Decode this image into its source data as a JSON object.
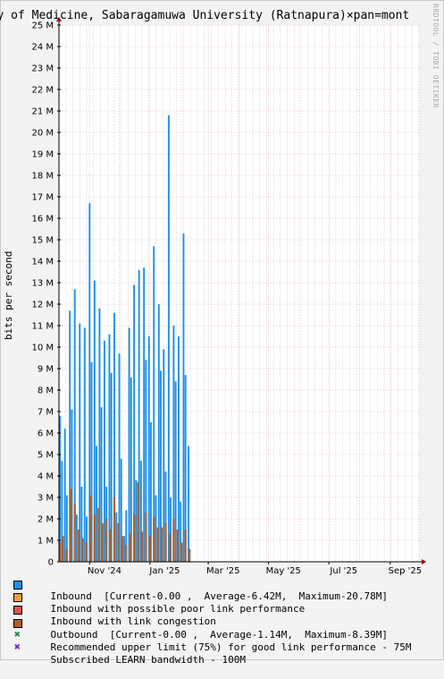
{
  "title": "ulty of Medicine, Sabaragamuwa University (Ratnapura)×pan=mont",
  "watermark": "RRDTOOL / TOBI OETIKER",
  "chart_data": {
    "type": "area",
    "ylabel": "bits per second",
    "ylim": [
      0,
      25000000
    ],
    "y_ticks": [
      "0",
      "1 M",
      "2 M",
      "3 M",
      "4 M",
      "5 M",
      "6 M",
      "7 M",
      "8 M",
      "9 M",
      "10 M",
      "11 M",
      "12 M",
      "13 M",
      "14 M",
      "15 M",
      "16 M",
      "17 M",
      "18 M",
      "19 M",
      "20 M",
      "21 M",
      "22 M",
      "23 M",
      "24 M",
      "25 M"
    ],
    "x_ticks": [
      "Nov '24",
      "Jan '25",
      "Mar '25",
      "May '25",
      "Jul '25",
      "Sep '25"
    ],
    "x_range": [
      "2024-10-01",
      "2025-10-01"
    ],
    "grid": true,
    "series": [
      {
        "name": "Inbound",
        "color": "#1e90e6",
        "x": [
          "2024-10-02",
          "2024-10-04",
          "2024-10-07",
          "2024-10-09",
          "2024-10-12",
          "2024-10-14",
          "2024-10-17",
          "2024-10-19",
          "2024-10-22",
          "2024-10-24",
          "2024-10-27",
          "2024-10-29",
          "2024-11-01",
          "2024-11-03",
          "2024-11-06",
          "2024-11-08",
          "2024-11-11",
          "2024-11-13",
          "2024-11-16",
          "2024-11-18",
          "2024-11-21",
          "2024-11-23",
          "2024-11-26",
          "2024-11-28",
          "2024-12-01",
          "2024-12-03",
          "2024-12-06",
          "2024-12-08",
          "2024-12-11",
          "2024-12-13",
          "2024-12-16",
          "2024-12-18",
          "2024-12-21",
          "2024-12-23",
          "2024-12-26",
          "2024-12-28",
          "2024-12-31",
          "2025-01-02",
          "2025-01-05",
          "2025-01-07",
          "2025-01-10",
          "2025-01-12",
          "2025-01-15",
          "2025-01-17",
          "2025-01-20",
          "2025-01-22",
          "2025-01-25",
          "2025-01-27",
          "2025-01-30",
          "2025-02-01",
          "2025-02-04",
          "2025-02-06",
          "2025-02-09",
          "2025-02-11",
          "2025-02-14",
          "2025-02-16",
          "2025-02-19",
          "2025-02-21"
        ],
        "values": [
          6800000,
          4700000,
          6200000,
          3100000,
          11700000,
          7100000,
          12700000,
          2200000,
          11100000,
          3500000,
          10900000,
          2100000,
          16700000,
          9300000,
          13100000,
          5400000,
          11800000,
          7200000,
          10300000,
          3500000,
          10600000,
          8800000,
          11600000,
          2300000,
          9700000,
          4800000,
          1200000,
          2400000,
          10900000,
          8600000,
          12900000,
          3800000,
          13600000,
          4700000,
          13700000,
          9400000,
          10500000,
          6500000,
          14700000,
          3100000,
          12000000,
          8900000,
          9900000,
          4200000,
          20800000,
          3000000,
          11000000,
          8400000,
          10500000,
          2800000,
          15300000,
          8700000,
          5400000,
          0,
          0,
          0,
          0,
          0
        ]
      },
      {
        "name": "Inbound with possible poor link performance",
        "color": "#f0a040",
        "values": []
      },
      {
        "name": "Inbound with link congestion",
        "color": "#e05050",
        "values": []
      },
      {
        "name": "Outbound",
        "color": "#b05e2a",
        "x": [
          "2024-10-02",
          "2024-10-05",
          "2024-10-09",
          "2024-10-13",
          "2024-10-17",
          "2024-10-21",
          "2024-10-25",
          "2024-10-29",
          "2024-11-02",
          "2024-11-06",
          "2024-11-10",
          "2024-11-14",
          "2024-11-18",
          "2024-11-22",
          "2024-11-26",
          "2024-11-30",
          "2024-12-04",
          "2024-12-08",
          "2024-12-12",
          "2024-12-16",
          "2024-12-20",
          "2024-12-24",
          "2024-12-28",
          "2025-01-01",
          "2025-01-05",
          "2025-01-09",
          "2025-01-13",
          "2025-01-17",
          "2025-01-21",
          "2025-01-25",
          "2025-01-29",
          "2025-02-02",
          "2025-02-06",
          "2025-02-10"
        ],
        "values": [
          900000,
          1200000,
          600000,
          3400000,
          2700000,
          1500000,
          1100000,
          900000,
          3100000,
          2200000,
          2500000,
          1800000,
          2000000,
          1500000,
          3000000,
          1800000,
          1200000,
          800000,
          1300000,
          2200000,
          3700000,
          1400000,
          2300000,
          1200000,
          2100000,
          1600000,
          1600000,
          1800000,
          1300000,
          2000000,
          1500000,
          900000,
          1500000,
          600000
        ]
      },
      {
        "name": "Recommended upper limit (75%) for good link performance - 75M",
        "color": "#2e8b57",
        "values": []
      },
      {
        "name": "Subscribed LEARN bandwidth - 100M",
        "color": "#7b2fbf",
        "values": []
      }
    ]
  },
  "legend": {
    "inbound": "Inbound  [Current-0.00 ,  Average-6.42M,  Maximum-20.78M]",
    "inbound_poor": "Inbound with possible poor link performance",
    "inbound_congestion": "Inbound with link congestion",
    "outbound": "Outbound  [Current-0.00 ,  Average-1.14M,  Maximum-8.39M]",
    "recommended": "Recommended upper limit (75%) for good link performance - 75M",
    "subscribed": "Subscribed LEARN bandwidth - 100M"
  }
}
